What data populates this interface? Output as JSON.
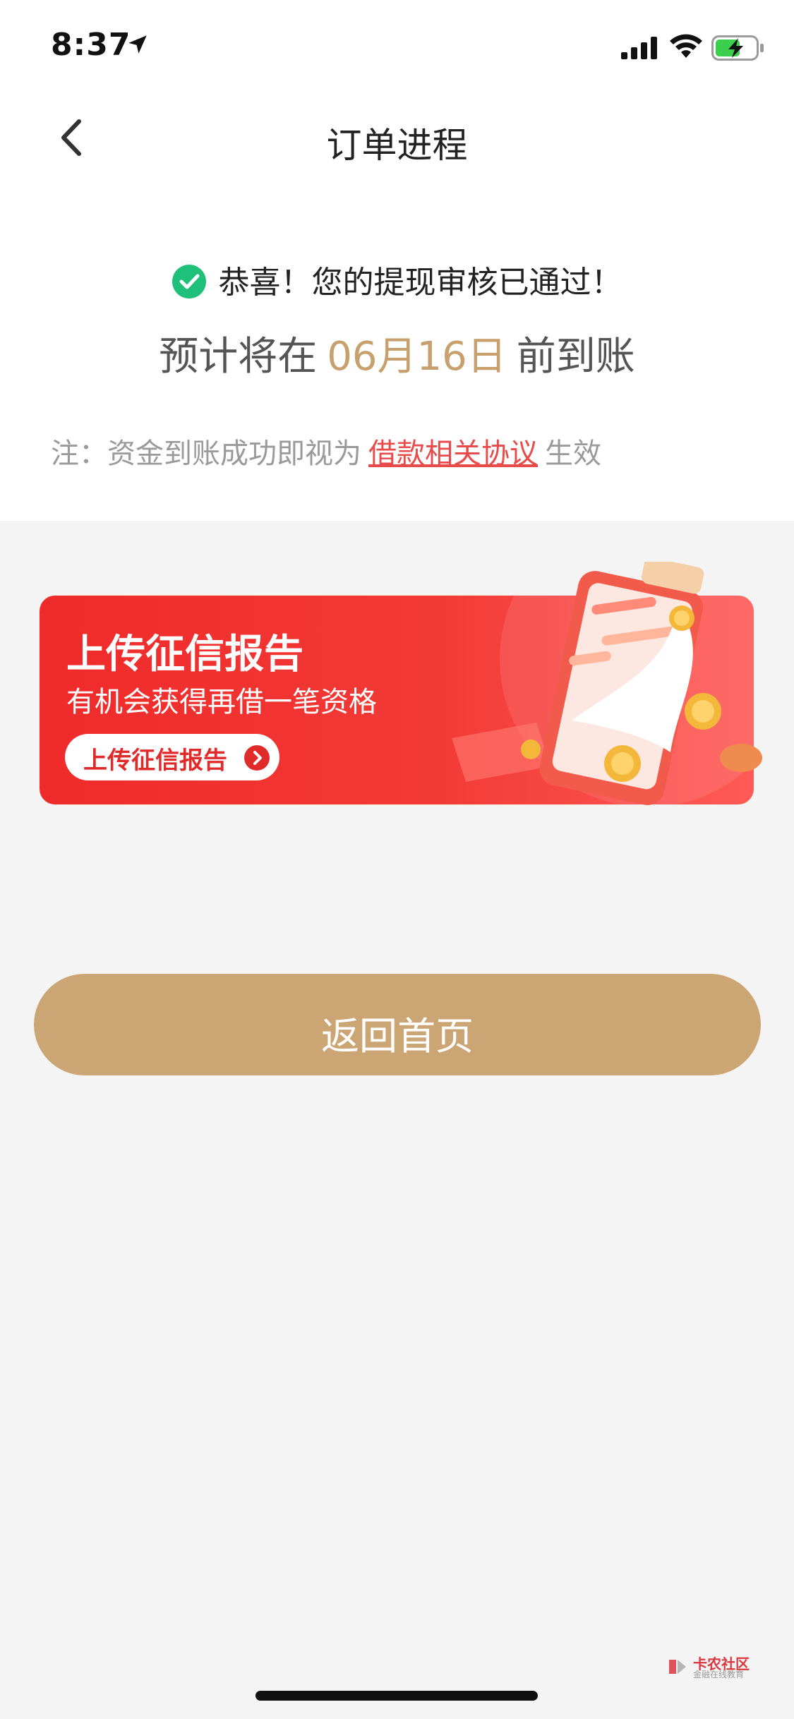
{
  "status_bar": {
    "time": "8:37"
  },
  "nav": {
    "title": "订单进程"
  },
  "result": {
    "message": "恭喜！您的提现审核已通过！",
    "estimate_prefix": "预计将在",
    "estimate_date": "06月16日",
    "estimate_suffix": "前到账",
    "note_prefix": "注：资金到账成功即视为",
    "note_link": "借款相关协议",
    "note_suffix": "生效"
  },
  "banner": {
    "title": "上传征信报告",
    "subtitle": "有机会获得再借一笔资格",
    "button_label": "上传征信报告"
  },
  "actions": {
    "home_label": "返回首页"
  },
  "watermark": {
    "name": "卡农社区",
    "sub": "金融在线教育"
  },
  "colors": {
    "accent_gold": "#cca574",
    "date_gold": "#c7a06d",
    "success_green": "#1fc07a",
    "banner_red": "#ef2a2a",
    "link_red": "#e94a4a"
  }
}
